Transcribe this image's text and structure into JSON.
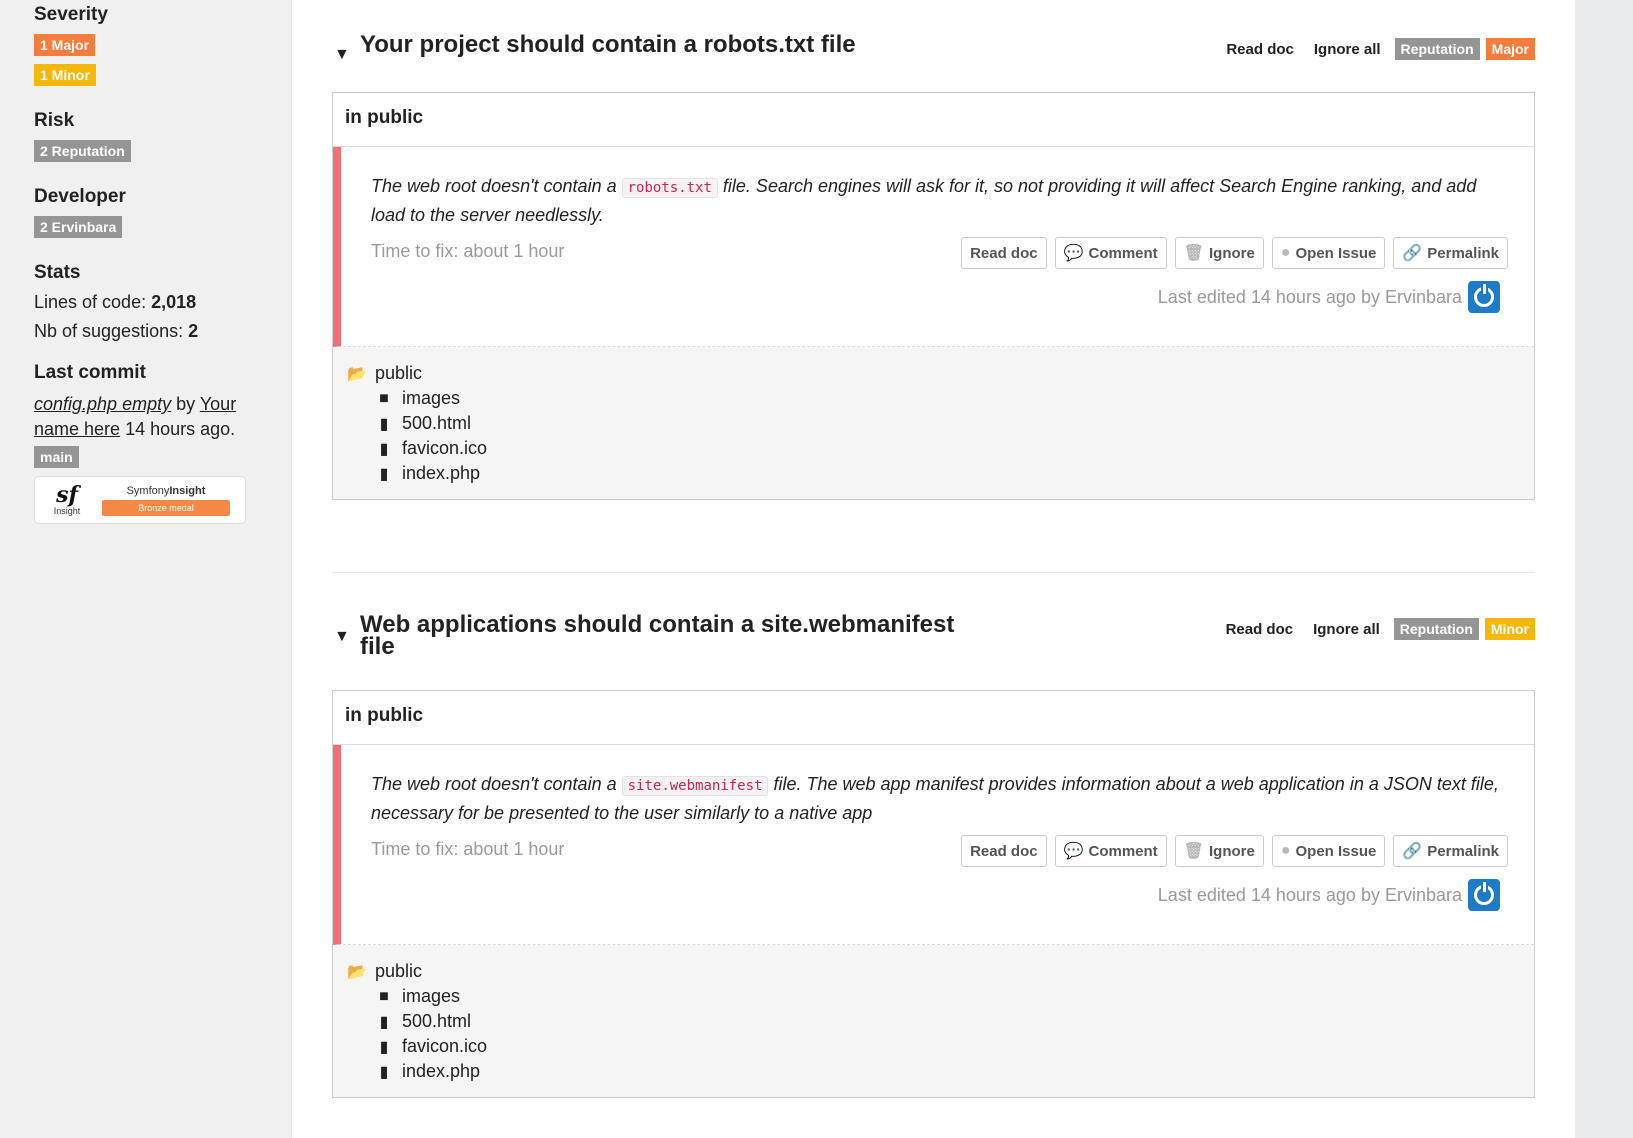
{
  "sidebar": {
    "severity": {
      "title": "Severity",
      "major": "1 Major",
      "minor": "1 Minor"
    },
    "risk": {
      "title": "Risk",
      "badge": "2 Reputation"
    },
    "developer": {
      "title": "Developer",
      "badge": "2 Ervinbara"
    },
    "stats": {
      "title": "Stats",
      "loc_label": "Lines of code:",
      "loc_value": "2,018",
      "sugg_label": "Nb of suggestions:",
      "sugg_value": "2"
    },
    "last_commit": {
      "title": "Last commit",
      "commit_msg": "config.php empty",
      "by": "by",
      "author": "Your name here",
      "when": "14 hours ago.",
      "branch": "main"
    },
    "medal": {
      "logo_sf": "sf",
      "logo_insight": "Insight",
      "brand_light": "Symfony",
      "brand_bold": "Insight",
      "label": "Bronze medal"
    }
  },
  "issues": [
    {
      "title_line1": "Your project should contain a robots.txt file",
      "title_line2": "",
      "read_doc": "Read doc",
      "ignore_all": "Ignore all",
      "category": "Reputation",
      "severity": "Major",
      "severity_color": "#f47c3c",
      "location": "in public",
      "desc_before": "The web root doesn't contain a",
      "desc_code": "robots.txt",
      "desc_after": "file. Search engines will ask for it, so not providing it will affect Search Engine ranking, and add load to the server needlessly.",
      "time_to_fix": "Time to fix: about 1 hour",
      "buttons": {
        "read_doc": "Read doc",
        "comment": "Comment",
        "ignore": "Ignore",
        "open_issue": "Open Issue",
        "permalink": "Permalink"
      },
      "edited": "Last edited 14 hours ago by Ervinbara",
      "tree": {
        "root": "public",
        "children": [
          "images",
          "500.html",
          "favicon.ico",
          "index.php"
        ]
      }
    },
    {
      "title_line1": "Web applications should contain a site.webmanifest",
      "title_line2": "file",
      "read_doc": "Read doc",
      "ignore_all": "Ignore all",
      "category": "Reputation",
      "severity": "Minor",
      "severity_color": "#f5b80a",
      "location": "in public",
      "desc_before": "The web root doesn't contain a",
      "desc_code": "site.webmanifest",
      "desc_after": "file. The web app manifest provides information about a web application in a JSON text file, necessary for be presented to the user similarly to a native app",
      "time_to_fix": "Time to fix: about 1 hour",
      "buttons": {
        "read_doc": "Read doc",
        "comment": "Comment",
        "ignore": "Ignore",
        "open_issue": "Open Issue",
        "permalink": "Permalink"
      },
      "edited": "Last edited 14 hours ago by Ervinbara",
      "tree": {
        "root": "public",
        "children": [
          "images",
          "500.html",
          "favicon.ico",
          "index.php"
        ]
      }
    }
  ]
}
